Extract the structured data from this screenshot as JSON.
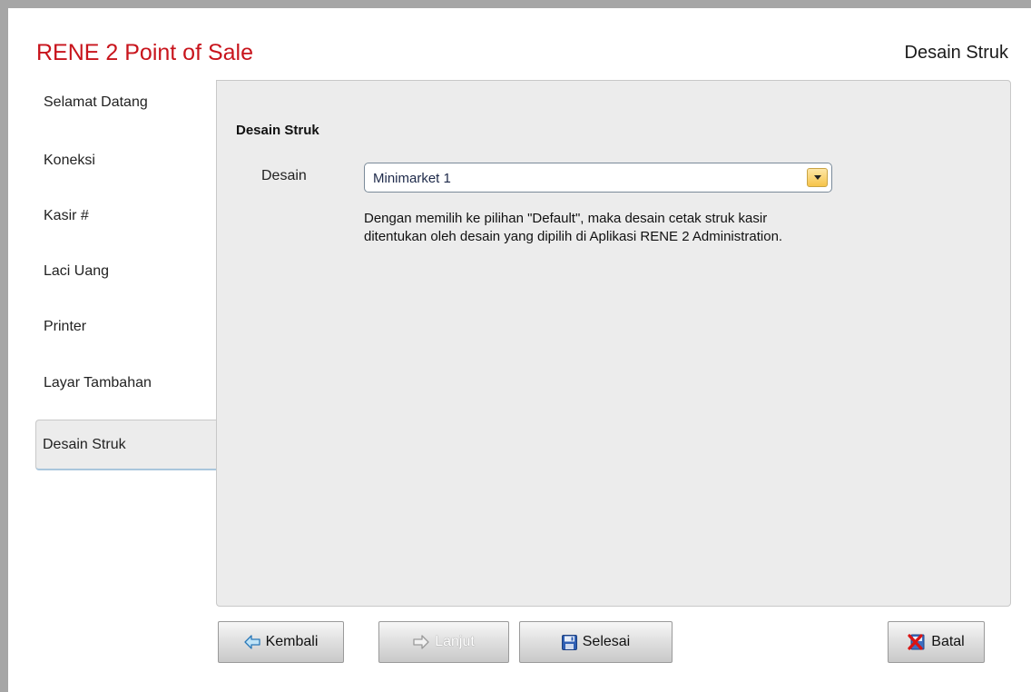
{
  "app": {
    "title": "RENE 2 Point of Sale",
    "page_heading": "Desain Struk"
  },
  "sidebar": {
    "items": [
      {
        "label": "Selamat Datang",
        "active": false
      },
      {
        "label": "Koneksi",
        "active": false
      },
      {
        "label": "Kasir #",
        "active": false
      },
      {
        "label": "Laci Uang",
        "active": false
      },
      {
        "label": "Printer",
        "active": false
      },
      {
        "label": "Layar Tambahan",
        "active": false
      },
      {
        "label": "Desain Struk",
        "active": true
      }
    ]
  },
  "main": {
    "section_title": "Desain Struk",
    "design_label": "Desain",
    "design_select": {
      "selected": "Minimarket 1",
      "arrow_icon": "chevron-down-icon"
    },
    "help_line1": "Dengan memilih ke pilihan \"Default\", maka desain cetak struk kasir",
    "help_line2": "ditentukan oleh desain yang dipilih di Aplikasi RENE 2 Administration."
  },
  "footer": {
    "back_label": "Kembali",
    "next_label": "Lanjut",
    "finish_label": "Selesai",
    "cancel_label": "Batal",
    "next_disabled": true,
    "icons": {
      "back": "arrow-left-icon",
      "next": "arrow-right-icon",
      "finish": "floppy-disk-icon",
      "cancel": "red-x-icon"
    }
  },
  "colors": {
    "title_red": "#c8141c",
    "panel_bg": "#ececec",
    "frame_gray": "#a6a6a6",
    "combo_arrow": "#f6c44a"
  }
}
